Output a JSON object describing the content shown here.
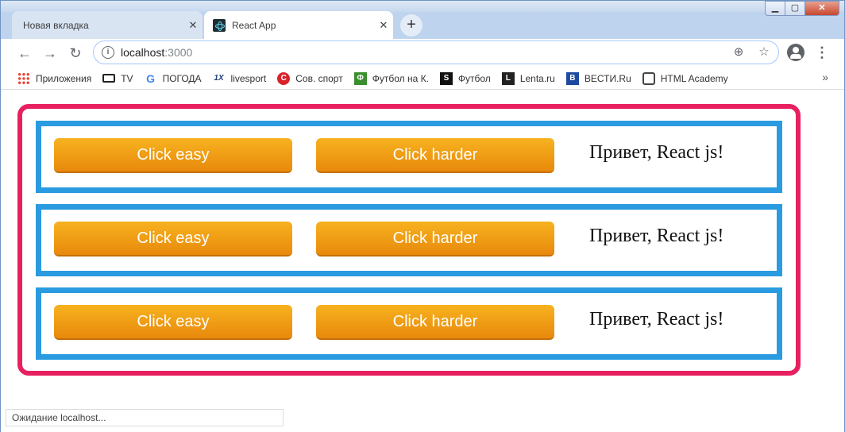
{
  "window": {
    "controls": {
      "minimize": "▁",
      "maximize": "▢",
      "close": "✕"
    }
  },
  "tabs": [
    {
      "label": "Новая вкладка",
      "active": false,
      "close": "✕"
    },
    {
      "label": "React App",
      "active": true,
      "close": "✕",
      "icon": "react-icon"
    }
  ],
  "new_tab_label": "+",
  "toolbar": {
    "back": "←",
    "forward": "→",
    "reload": "↻",
    "url_host": "localhost",
    "url_port": ":3000",
    "info": "i",
    "zoom": "⊕",
    "star": "☆",
    "menu": "⋮"
  },
  "bookmarks": [
    {
      "label": "Приложения",
      "icon": "apps-icon"
    },
    {
      "label": "TV",
      "icon": "tv-icon"
    },
    {
      "label": "ПОГОДА",
      "icon": "google-icon",
      "glyph": "G"
    },
    {
      "label": "livesport",
      "icon": "livesport-icon",
      "glyph": "1X"
    },
    {
      "label": "Сов. спорт",
      "icon": "sovsport-icon",
      "glyph": "С"
    },
    {
      "label": "Футбол на К.",
      "icon": "football-icon",
      "glyph": "Ф"
    },
    {
      "label": "Футбол",
      "icon": "s-icon",
      "glyph": "S"
    },
    {
      "label": "Lenta.ru",
      "icon": "lenta-icon",
      "glyph": "L"
    },
    {
      "label": "ВЕСТИ.Ru",
      "icon": "vesti-icon",
      "glyph": "B"
    },
    {
      "label": "HTML Academy",
      "icon": "htmlacademy-icon",
      "glyph": ""
    }
  ],
  "bookmarks_more": "»",
  "rows": [
    {
      "easy": "Click easy",
      "harder": "Click harder",
      "greeting": "Привет, React js!"
    },
    {
      "easy": "Click easy",
      "harder": "Click harder",
      "greeting": "Привет, React js!"
    },
    {
      "easy": "Click easy",
      "harder": "Click harder",
      "greeting": "Привет, React js!"
    }
  ],
  "status": "Ожидание localhost...",
  "colors": {
    "outer_border": "#e8205f",
    "row_border": "#2a9be0",
    "button_top": "#f7b21f",
    "button_bottom": "#e8890c"
  }
}
